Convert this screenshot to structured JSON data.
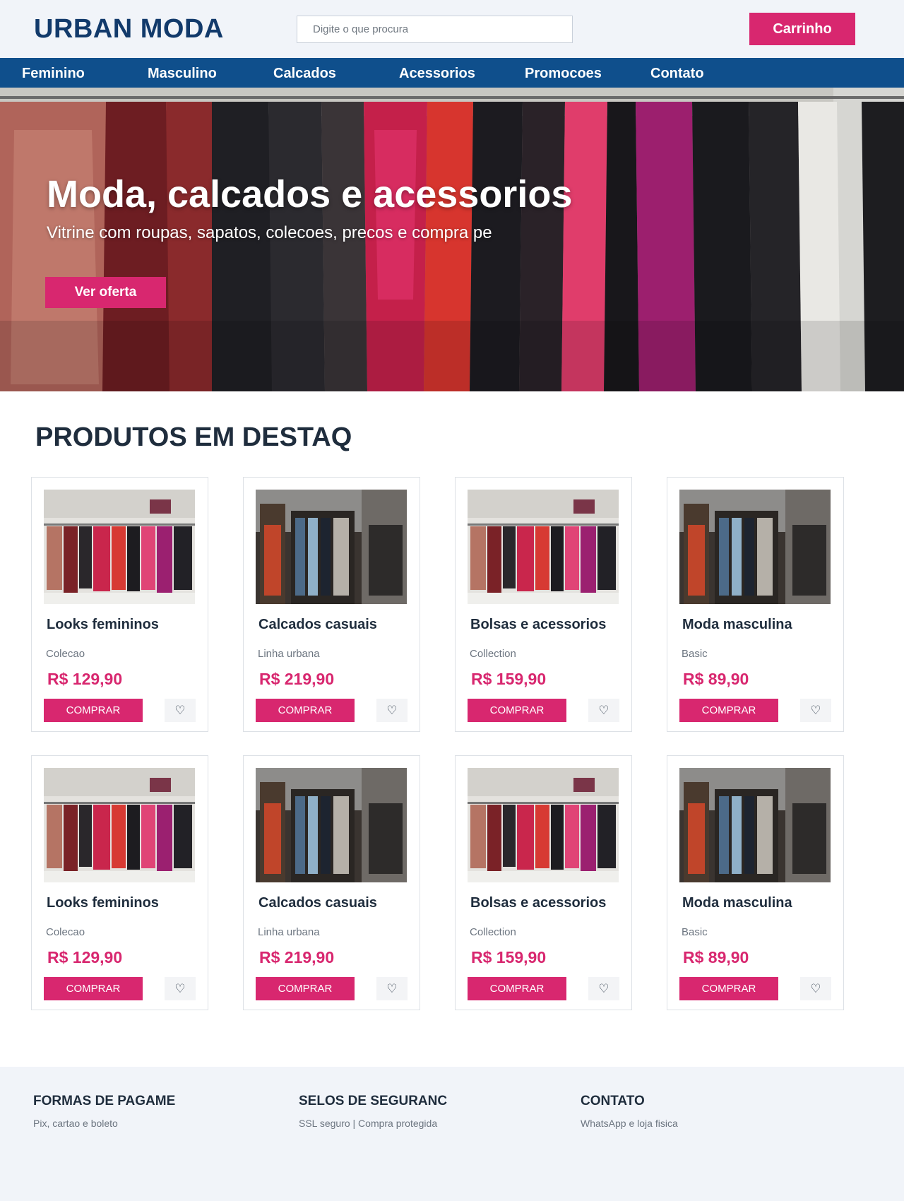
{
  "header": {
    "logo": "URBAN MODA",
    "search_placeholder": "Digite o que procura",
    "cart_label": "Carrinho"
  },
  "nav": {
    "items": [
      {
        "label": "Feminino"
      },
      {
        "label": "Masculino"
      },
      {
        "label": "Calcados"
      },
      {
        "label": "Acessorios"
      },
      {
        "label": "Promocoes"
      },
      {
        "label": "Contato"
      }
    ]
  },
  "hero": {
    "title": "Moda, calcados e acessorios",
    "subtitle": "Vitrine com roupas, sapatos, colecoes, precos e compra pe",
    "button": "Ver oferta"
  },
  "products": {
    "title": "PRODUTOS EM DESTAQ",
    "buy_label": "COMPRAR",
    "fav_icon": "heart-icon",
    "items": [
      {
        "name": "Looks femininos",
        "line": "Colecao",
        "price": "R$ 129,90",
        "image": "rack-store"
      },
      {
        "name": "Calcados casuais",
        "line": "Linha urbana",
        "price": "R$ 219,90",
        "image": "closet"
      },
      {
        "name": "Bolsas e acessorios",
        "line": "Collection",
        "price": "R$ 159,90",
        "image": "rack-store"
      },
      {
        "name": "Moda masculina",
        "line": "Basic",
        "price": "R$ 89,90",
        "image": "closet"
      },
      {
        "name": "Looks femininos",
        "line": "Colecao",
        "price": "R$ 129,90",
        "image": "rack-store"
      },
      {
        "name": "Calcados casuais",
        "line": "Linha urbana",
        "price": "R$ 219,90",
        "image": "closet"
      },
      {
        "name": "Bolsas e acessorios",
        "line": "Collection",
        "price": "R$ 159,90",
        "image": "rack-store"
      },
      {
        "name": "Moda masculina",
        "line": "Basic",
        "price": "R$ 89,90",
        "image": "closet"
      }
    ]
  },
  "footer": {
    "columns": [
      {
        "title": "FORMAS DE PAGAME",
        "text": "Pix, cartao e boleto"
      },
      {
        "title": "SELOS DE SEGURANC",
        "text": "SSL seguro | Compra protegida"
      },
      {
        "title": "CONTATO",
        "text": "WhatsApp e loja fisica"
      }
    ]
  },
  "colors": {
    "brand": "#123a6b",
    "nav": "#0f4f8c",
    "accent": "#d8276f"
  }
}
